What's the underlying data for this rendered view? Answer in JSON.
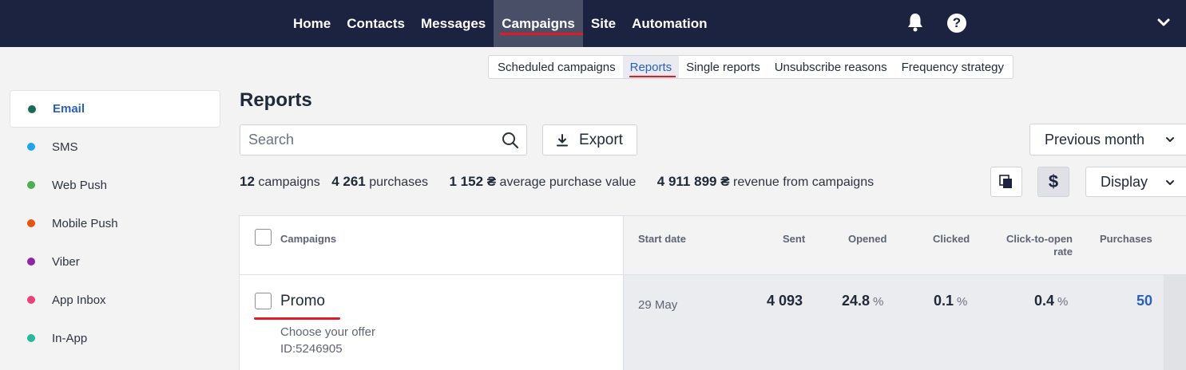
{
  "nav": {
    "items": [
      {
        "label": "Home"
      },
      {
        "label": "Contacts"
      },
      {
        "label": "Messages"
      },
      {
        "label": "Campaigns",
        "active": true
      },
      {
        "label": "Site"
      },
      {
        "label": "Automation"
      }
    ],
    "help_label": "?"
  },
  "subnav": {
    "items": [
      {
        "label": "Scheduled campaigns"
      },
      {
        "label": "Reports",
        "active": true
      },
      {
        "label": "Single reports"
      },
      {
        "label": "Unsubscribe reasons"
      },
      {
        "label": "Frequency strategy"
      }
    ]
  },
  "sidebar": {
    "items": [
      {
        "label": "Email",
        "color": "#1a6b55",
        "active": true
      },
      {
        "label": "SMS",
        "color": "#1ea7e8"
      },
      {
        "label": "Web Push",
        "color": "#4caf50"
      },
      {
        "label": "Mobile Push",
        "color": "#e8540f"
      },
      {
        "label": "Viber",
        "color": "#8e24aa"
      },
      {
        "label": "App Inbox",
        "color": "#ec407a"
      },
      {
        "label": "In-App",
        "color": "#26b99a"
      }
    ]
  },
  "page": {
    "title": "Reports",
    "search_placeholder": "Search",
    "export_label": "Export",
    "period_label": "Previous month",
    "display_label": "Display",
    "currency_symbol": "$"
  },
  "stats": {
    "campaigns_value": "12",
    "campaigns_label": "campaigns",
    "purchases_value": "4 261",
    "purchases_label": "purchases",
    "avg_value": "1 152 ₴",
    "avg_label": "average purchase value",
    "revenue_value": "4 911 899 ₴",
    "revenue_label": "revenue from campaigns"
  },
  "table": {
    "headers": {
      "campaigns": "Campaigns",
      "start_date": "Start date",
      "sent": "Sent",
      "opened": "Opened",
      "clicked": "Clicked",
      "cto_line1": "Click-to-open",
      "cto_line2": "rate",
      "purchases": "Purchases"
    },
    "rows": [
      {
        "name": "Promo",
        "subject": "Choose your offer",
        "id": "ID:5246905",
        "start_date": "29 May",
        "sent": "4 093",
        "opened": "24.8",
        "clicked": "0.1",
        "cto": "0.4",
        "pct": "%",
        "purchases": "50"
      }
    ]
  }
}
